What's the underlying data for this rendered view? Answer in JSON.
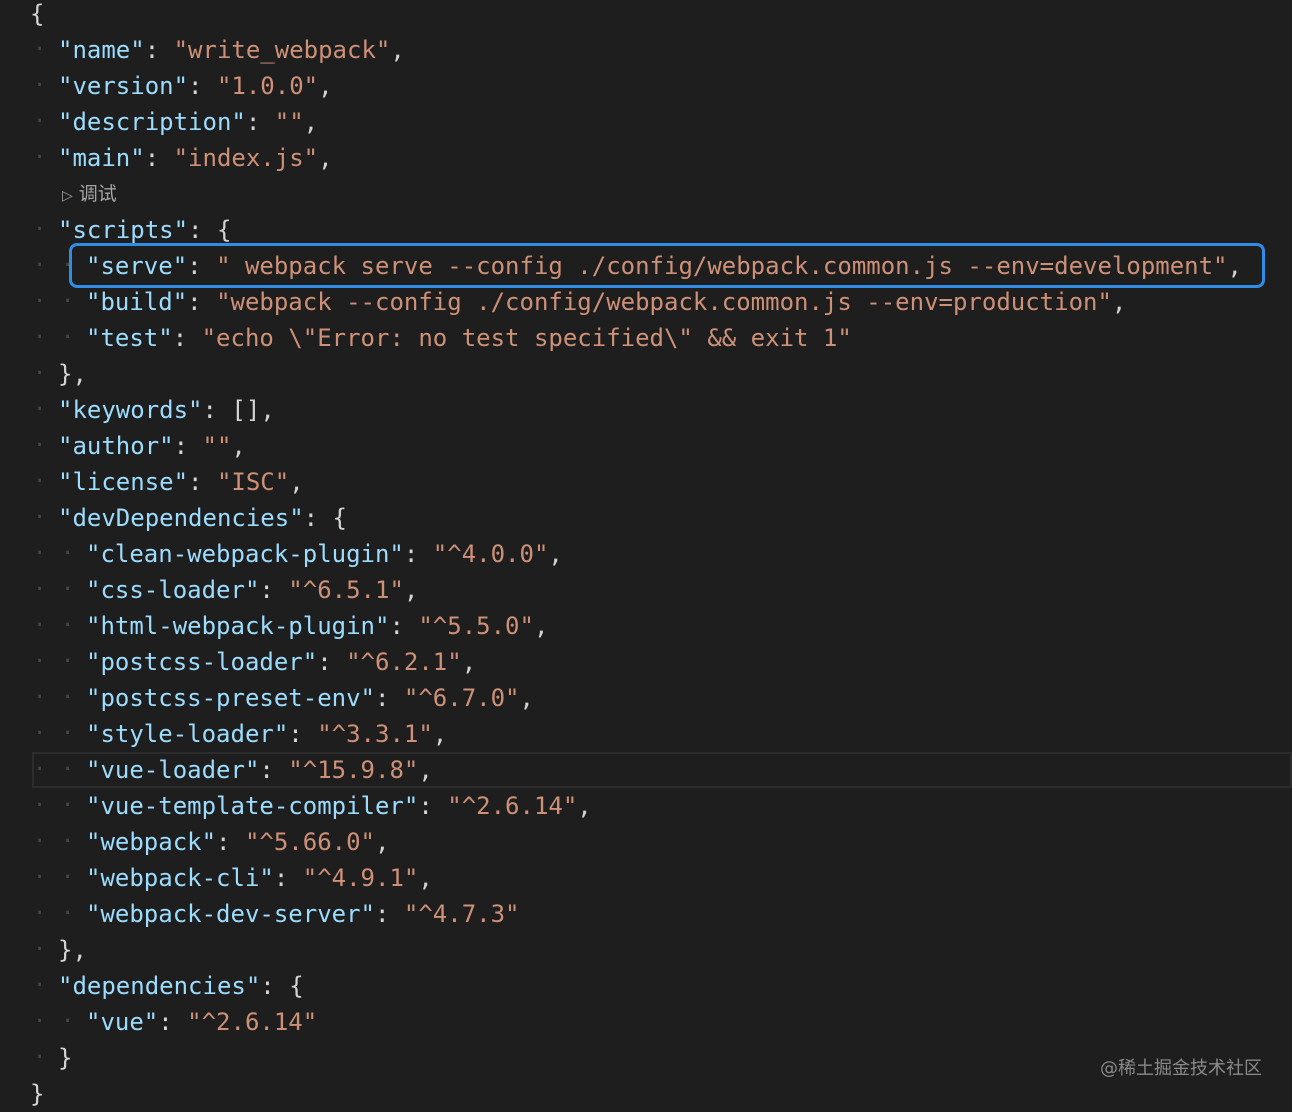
{
  "editor": {
    "open_brace": "{",
    "close_brace": "}",
    "codelens_label": "调试",
    "fields": {
      "name_key": "\"name\"",
      "name_value": "\"write_webpack\"",
      "version_key": "\"version\"",
      "version_value": "\"1.0.0\"",
      "description_key": "\"description\"",
      "description_value": "\"\"",
      "main_key": "\"main\"",
      "main_value": "\"index.js\"",
      "scripts_key": "\"scripts\"",
      "keywords_key": "\"keywords\"",
      "keywords_value": "[]",
      "author_key": "\"author\"",
      "author_value": "\"\"",
      "license_key": "\"license\"",
      "license_value": "\"ISC\"",
      "devDependencies_key": "\"devDependencies\"",
      "dependencies_key": "\"dependencies\""
    },
    "scripts": [
      {
        "key": "\"serve\"",
        "value": "\" webpack serve --config ./config/webpack.common.js --env=development\""
      },
      {
        "key": "\"build\"",
        "value": "\"webpack --config ./config/webpack.common.js --env=production\""
      },
      {
        "key": "\"test\"",
        "value": "\"echo \\\"Error: no test specified\\\" && exit 1\""
      }
    ],
    "devDependencies": [
      {
        "key": "\"clean-webpack-plugin\"",
        "value": "\"^4.0.0\""
      },
      {
        "key": "\"css-loader\"",
        "value": "\"^6.5.1\""
      },
      {
        "key": "\"html-webpack-plugin\"",
        "value": "\"^5.5.0\""
      },
      {
        "key": "\"postcss-loader\"",
        "value": "\"^6.2.1\""
      },
      {
        "key": "\"postcss-preset-env\"",
        "value": "\"^6.7.0\""
      },
      {
        "key": "\"style-loader\"",
        "value": "\"^3.3.1\""
      },
      {
        "key": "\"vue-loader\"",
        "value": "\"^15.9.8\""
      },
      {
        "key": "\"vue-template-compiler\"",
        "value": "\"^2.6.14\""
      },
      {
        "key": "\"webpack\"",
        "value": "\"^5.66.0\""
      },
      {
        "key": "\"webpack-cli\"",
        "value": "\"^4.9.1\""
      },
      {
        "key": "\"webpack-dev-server\"",
        "value": "\"^4.7.3\""
      }
    ],
    "dependencies": [
      {
        "key": "\"vue\"",
        "value": "\"^2.6.14\""
      }
    ]
  },
  "watermark": "@稀土掘金技术社区",
  "colors": {
    "background": "#1e1e1e",
    "json_key": "#9cdcfe",
    "json_string": "#ce9178",
    "punctuation": "#d4d4d4",
    "highlight_border": "#2f8de8"
  }
}
